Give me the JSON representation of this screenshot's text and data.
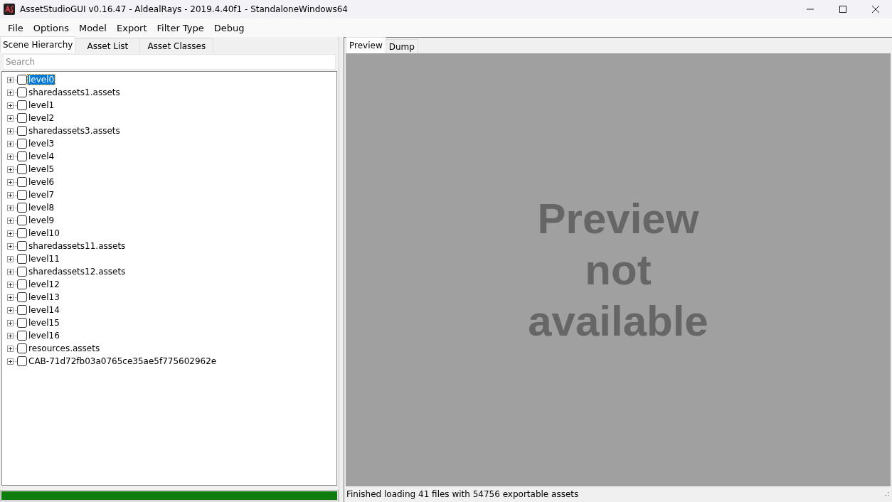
{
  "window": {
    "title": "AssetStudioGUI v0.16.47 - AldealRays - 2019.4.40f1 - StandaloneWindows64"
  },
  "menu": [
    "File",
    "Options",
    "Model",
    "Export",
    "Filter Type",
    "Debug"
  ],
  "left_tabs": [
    {
      "label": "Scene Hierarchy",
      "selected": true
    },
    {
      "label": "Asset List",
      "selected": false
    },
    {
      "label": "Asset Classes",
      "selected": false
    }
  ],
  "search": {
    "placeholder": "Search"
  },
  "tree": [
    {
      "label": "level0",
      "expanded": false,
      "checked": false,
      "selected": true
    },
    {
      "label": "sharedassets1.assets",
      "expanded": false,
      "checked": false,
      "selected": false
    },
    {
      "label": "level1",
      "expanded": false,
      "checked": false,
      "selected": false
    },
    {
      "label": "level2",
      "expanded": false,
      "checked": false,
      "selected": false
    },
    {
      "label": "sharedassets3.assets",
      "expanded": false,
      "checked": false,
      "selected": false
    },
    {
      "label": "level3",
      "expanded": false,
      "checked": false,
      "selected": false
    },
    {
      "label": "level4",
      "expanded": false,
      "checked": false,
      "selected": false
    },
    {
      "label": "level5",
      "expanded": false,
      "checked": false,
      "selected": false
    },
    {
      "label": "level6",
      "expanded": false,
      "checked": false,
      "selected": false
    },
    {
      "label": "level7",
      "expanded": false,
      "checked": false,
      "selected": false
    },
    {
      "label": "level8",
      "expanded": false,
      "checked": false,
      "selected": false
    },
    {
      "label": "level9",
      "expanded": false,
      "checked": false,
      "selected": false
    },
    {
      "label": "level10",
      "expanded": false,
      "checked": false,
      "selected": false
    },
    {
      "label": "sharedassets11.assets",
      "expanded": false,
      "checked": false,
      "selected": false
    },
    {
      "label": "level11",
      "expanded": false,
      "checked": false,
      "selected": false
    },
    {
      "label": "sharedassets12.assets",
      "expanded": false,
      "checked": false,
      "selected": false
    },
    {
      "label": "level12",
      "expanded": false,
      "checked": false,
      "selected": false
    },
    {
      "label": "level13",
      "expanded": false,
      "checked": false,
      "selected": false
    },
    {
      "label": "level14",
      "expanded": false,
      "checked": false,
      "selected": false
    },
    {
      "label": "level15",
      "expanded": false,
      "checked": false,
      "selected": false
    },
    {
      "label": "level16",
      "expanded": false,
      "checked": false,
      "selected": false
    },
    {
      "label": "resources.assets",
      "expanded": false,
      "checked": false,
      "selected": false
    },
    {
      "label": "CAB-71d72fb03a0765ce35ae5f775602962e",
      "expanded": false,
      "checked": false,
      "selected": false
    }
  ],
  "progress": {
    "level": 1
  },
  "right_tabs": [
    {
      "label": "Preview",
      "selected": true
    },
    {
      "label": "Dump",
      "selected": false
    }
  ],
  "preview": {
    "message_lines": [
      "Preview",
      "not",
      "available"
    ]
  },
  "status_bar": "Finished loading 41 files with 54756 exportable assets"
}
